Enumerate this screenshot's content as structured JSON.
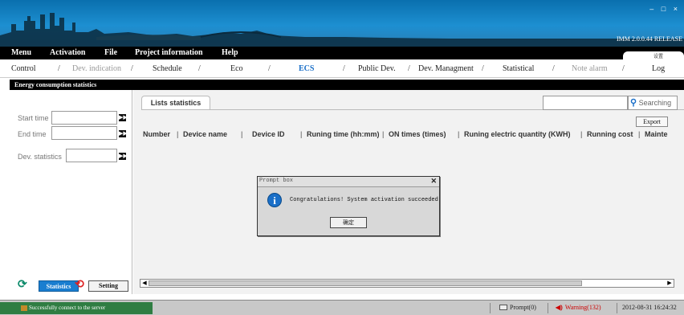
{
  "window": {
    "version": "IMM 2.0.0.44 RELEASE",
    "controls": [
      "–",
      "□",
      "×"
    ]
  },
  "menubar": {
    "items": [
      "Menu",
      "Activation",
      "File",
      "Project information",
      "Help"
    ],
    "tab_label": "设置"
  },
  "nav": {
    "items": [
      "Control",
      "Dev. indication",
      "Schedule",
      "Eco",
      "ECS",
      "Public Dev.",
      "Dev. Managment",
      "Statistical",
      "Note alarm",
      "Log"
    ],
    "separator": "/",
    "active": "ECS"
  },
  "section": {
    "title": "Energy consumption statistics"
  },
  "filters": {
    "start_time_label": "Start time",
    "end_time_label": "End time",
    "dev_statistics_label": "Dev. statistics",
    "picker_glyph": "▶▶"
  },
  "left_footer": {
    "statistics_label": "Statistics",
    "setting_label": "Setting"
  },
  "content": {
    "tab_label": "Lists statistics",
    "search_label": "Searching",
    "export_label": "Export",
    "columns": [
      "Number",
      "Device name",
      "Device ID",
      "Runing time (hh:mm)",
      "ON times (times)",
      "Runing electric quantity (KWH)",
      "Running cost",
      "Mainte"
    ]
  },
  "dialog": {
    "title": "Prompt box",
    "message": "Congratulations! System activation succeeded",
    "ok_label": "确定"
  },
  "statusbar": {
    "connection": "Successfully connect to the server",
    "prompt": "Prompt(0)",
    "warning": "Warning(132)",
    "datetime": "2012-08-31 16:24:32"
  }
}
